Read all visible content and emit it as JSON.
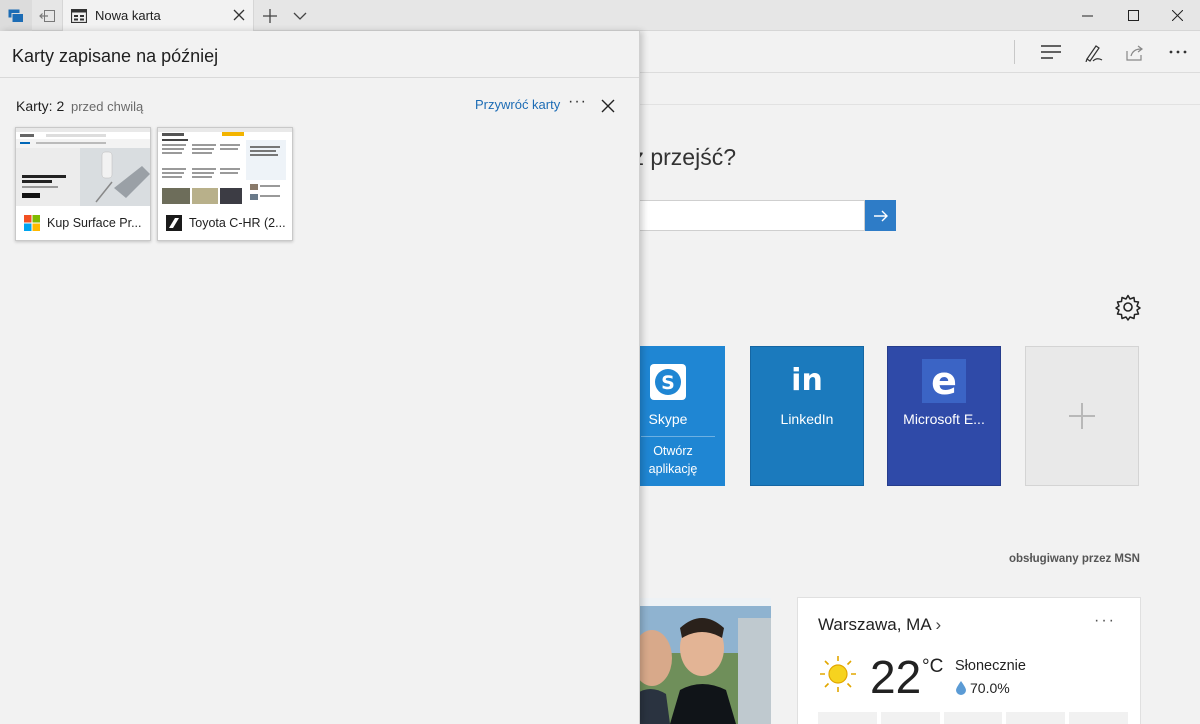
{
  "tab": {
    "title": "Nowa karta"
  },
  "ntp": {
    "heading": "z przejść?",
    "top_sites": [
      {
        "label": "Skype",
        "sub": "Otwórz aplikację",
        "color": "#1f86d3"
      },
      {
        "label": "LinkedIn",
        "color": "#1b7abd"
      },
      {
        "label": "Microsoft E...",
        "color": "#2f4aa8"
      }
    ],
    "msn_credit": "obsługiwany przez MSN",
    "weather": {
      "city": "Warszawa, MA",
      "temp": "22",
      "unit": "°C",
      "condition": "Słonecznie",
      "humidity": "70.0%"
    }
  },
  "panel": {
    "title": "Karty zapisane na później",
    "group": {
      "count": "Karty: 2",
      "time": "przed chwilą",
      "restore": "Przywróć karty"
    },
    "tabs": [
      {
        "label": "Kup Surface Pr..."
      },
      {
        "label": "Toyota C-HR (2..."
      }
    ]
  },
  "colors": {
    "accent": "#1c6cb5",
    "panel_bg": "#f2f2f2"
  }
}
